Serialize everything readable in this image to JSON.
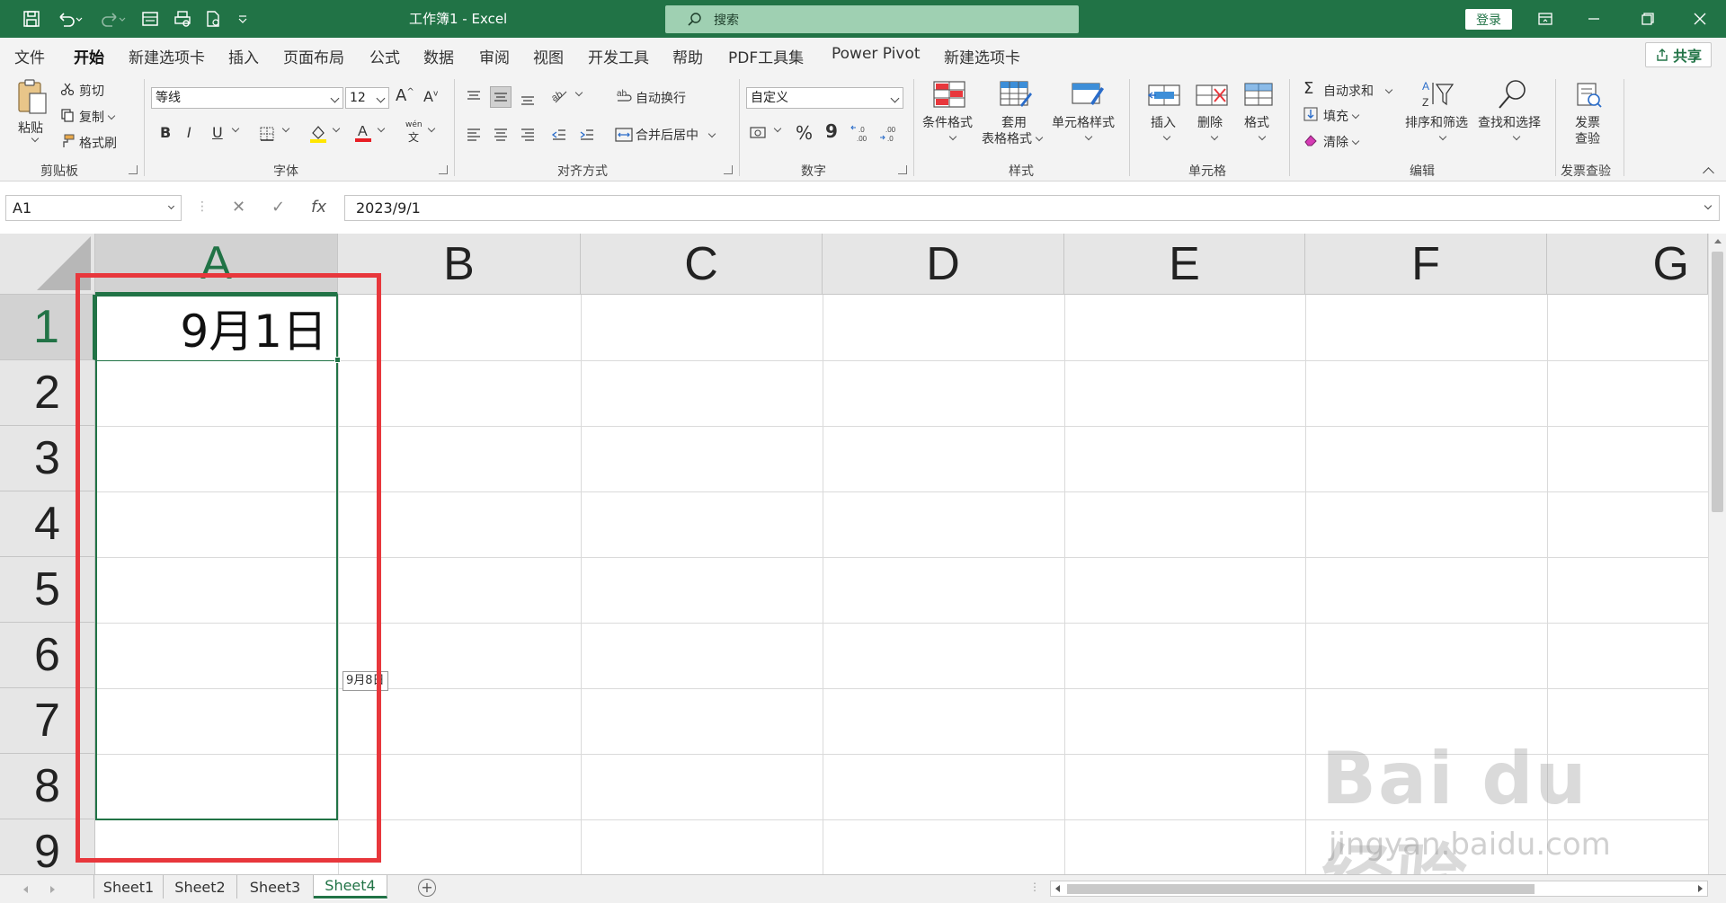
{
  "titlebar": {
    "title": "工作簿1  -  Excel",
    "search_placeholder": "搜索",
    "login": "登录"
  },
  "tabs": [
    "文件",
    "开始",
    "新建选项卡",
    "插入",
    "页面布局",
    "公式",
    "数据",
    "审阅",
    "视图",
    "开发工具",
    "帮助",
    "PDF工具集",
    "Power Pivot",
    "新建选项卡"
  ],
  "active_tab": "开始",
  "share_label": "共享",
  "ribbon": {
    "clipboard": {
      "paste": "粘贴",
      "cut": "剪切",
      "copy": "复制",
      "format_painter": "格式刷",
      "label": "剪贴板"
    },
    "font": {
      "font_name": "等线",
      "font_size": "12",
      "bold": "B",
      "italic": "I",
      "underline": "U",
      "label": "字体",
      "wen": "wén",
      "wen_char": "文"
    },
    "alignment": {
      "wrap": "自动换行",
      "merge": "合并后居中",
      "label": "对齐方式"
    },
    "number": {
      "format": "自定义",
      "percent": "%",
      "comma": "9",
      "label": "数字"
    },
    "styles": {
      "conditional": "条件格式",
      "table_line1": "套用",
      "table_line2": "表格格式",
      "cell_styles": "单元格样式",
      "label": "样式"
    },
    "cells": {
      "insert": "插入",
      "delete": "删除",
      "format": "格式",
      "label": "单元格"
    },
    "editing": {
      "autosum": "自动求和",
      "fill": "填充",
      "clear": "清除",
      "sort_filter": "排序和筛选",
      "find_select": "查找和选择",
      "label": "编辑"
    },
    "invoice": {
      "line1": "发票",
      "line2": "查验",
      "label": "发票查验"
    }
  },
  "formula_bar": {
    "name_box": "A1",
    "cancel": "✕",
    "enter": "✓",
    "fx": "fx",
    "value": "2023/9/1"
  },
  "grid": {
    "columns": [
      "A",
      "B",
      "C",
      "D",
      "E",
      "F",
      "G"
    ],
    "rows": [
      "1",
      "2",
      "3",
      "4",
      "5",
      "6",
      "7",
      "8",
      "9"
    ],
    "cell_a1": "9月1日",
    "fill_tooltip": "9月8日"
  },
  "sheets": [
    "Sheet1",
    "Sheet2",
    "Sheet3",
    "Sheet4"
  ],
  "active_sheet": "Sheet4",
  "add_sheet": "+",
  "watermark": {
    "brand": "Bai du 经验",
    "url": "jingyan.baidu.com"
  },
  "colors": {
    "excel_green": "#217346",
    "highlight_red": "#e8373c"
  }
}
